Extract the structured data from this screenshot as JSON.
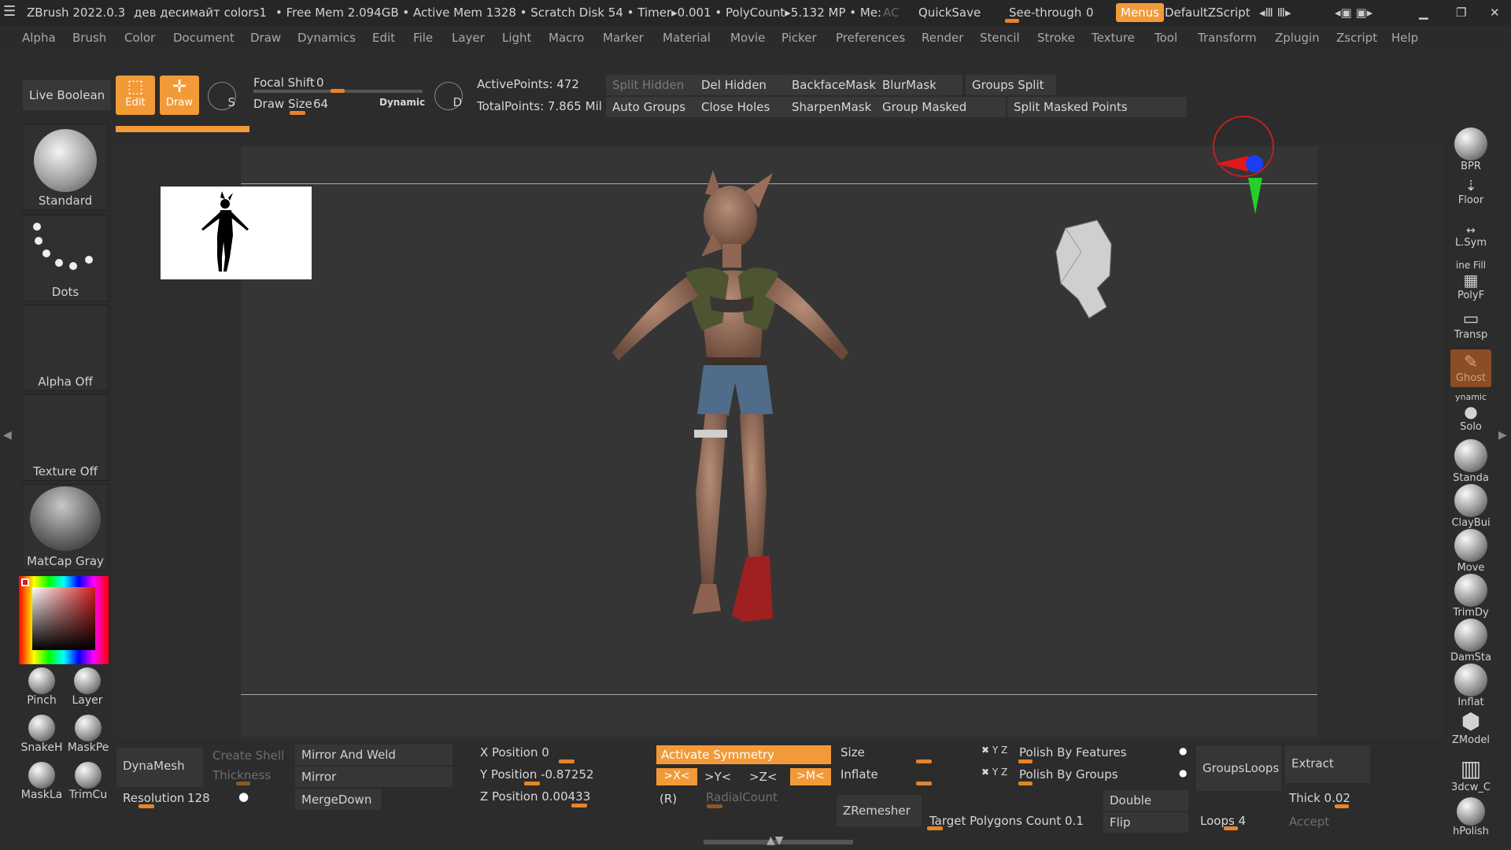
{
  "titlebar": {
    "app": "ZBrush 2022.0.3",
    "doc": "дев десимайт colors1",
    "stats": "• Free Mem 2.094GB • Active Mem 1328 • Scratch Disk 54 • Timer▸0.001 • PolyCount▸5.132 MP • Me:",
    "ac": "AC",
    "quicksave": "QuickSave",
    "seethrough_label": "See-through",
    "seethrough_value": "0",
    "menus": "Menus",
    "script": "DefaultZScript"
  },
  "menu": [
    "Alpha",
    "Brush",
    "Color",
    "Document",
    "Draw",
    "Dynamics",
    "Edit",
    "File",
    "Layer",
    "Light",
    "Macro",
    "Marker",
    "Material",
    "Movie",
    "Picker",
    "Preferences",
    "Render",
    "Stencil",
    "Stroke",
    "Texture",
    "Tool",
    "Transform",
    "Zplugin",
    "Zscript",
    "Help"
  ],
  "topshelf": {
    "live_boolean": "Live Boolean",
    "edit": "Edit",
    "draw": "Draw",
    "sym_s": "S",
    "sym_d": "D",
    "focal_shift_label": "Focal Shift",
    "focal_shift_value": "0",
    "draw_size_label": "Draw Size",
    "draw_size_value": "64",
    "dynamic": "Dynamic",
    "active_points": "ActivePoints: 472",
    "total_points": "TotalPoints: 7.865 Mil",
    "buttons_row1": [
      "Split Hidden",
      "Del Hidden",
      "BackfaceMask",
      "BlurMask",
      "Groups Split"
    ],
    "buttons_row2": [
      "Auto Groups",
      "Close Holes",
      "SharpenMask",
      "Group Masked",
      "Split Masked Points"
    ]
  },
  "leftshelf": {
    "brush": "Standard",
    "stroke": "Dots",
    "alpha": "Alpha Off",
    "texture": "Texture Off",
    "material": "MatCap Gray",
    "mini_brushes": [
      "Pinch",
      "Layer",
      "SnakeH",
      "MaskPe",
      "MaskLa",
      "TrimCu"
    ]
  },
  "rightshelf": [
    "BPR",
    "Floor",
    "L.Sym",
    "PolyF",
    "Transp",
    "Ghost",
    "Solo",
    "Standa",
    "ClayBui",
    "Move",
    "TrimDy",
    "DamSta",
    "Inflat",
    "ZModel",
    "3dcw_C",
    "hPolish"
  ],
  "rightshelf_extra": {
    "line_fill": "ine Fill",
    "dynamic": "ynamic"
  },
  "bottom": {
    "dynamesh": "DynaMesh",
    "resolution_label": "Resolution",
    "resolution_value": "128",
    "create_shell": "Create Shell",
    "thickness": "Thickness",
    "mirror_and_weld": "Mirror And Weld",
    "mirror": "Mirror",
    "mergedown": "MergeDown",
    "x_position": "X Position 0",
    "y_position": "Y Position -0.87252",
    "z_position": "Z Position 0.00433",
    "activate_symmetry": "Activate Symmetry",
    "sym_x": ">X<",
    "sym_y": ">Y<",
    "sym_z": ">Z<",
    "sym_m": ">M<",
    "sym_r": "(R)",
    "radialcount": "RadialCount",
    "size": "Size",
    "inflate": "Inflate",
    "zremesher": "ZRemesher",
    "target_polys": "Target Polygons Count 0.1",
    "polish_features": "Polish By Features",
    "polish_groups": "Polish By Groups",
    "double": "Double",
    "flip": "Flip",
    "loops": "Loops 4",
    "groupsloops": "GroupsLoops",
    "extract": "Extract",
    "thick": "Thick 0.02",
    "accept": "Accept"
  },
  "colors": {
    "accent": "#f29a38",
    "bg": "#2c2c2c",
    "canvas": "#353535"
  }
}
